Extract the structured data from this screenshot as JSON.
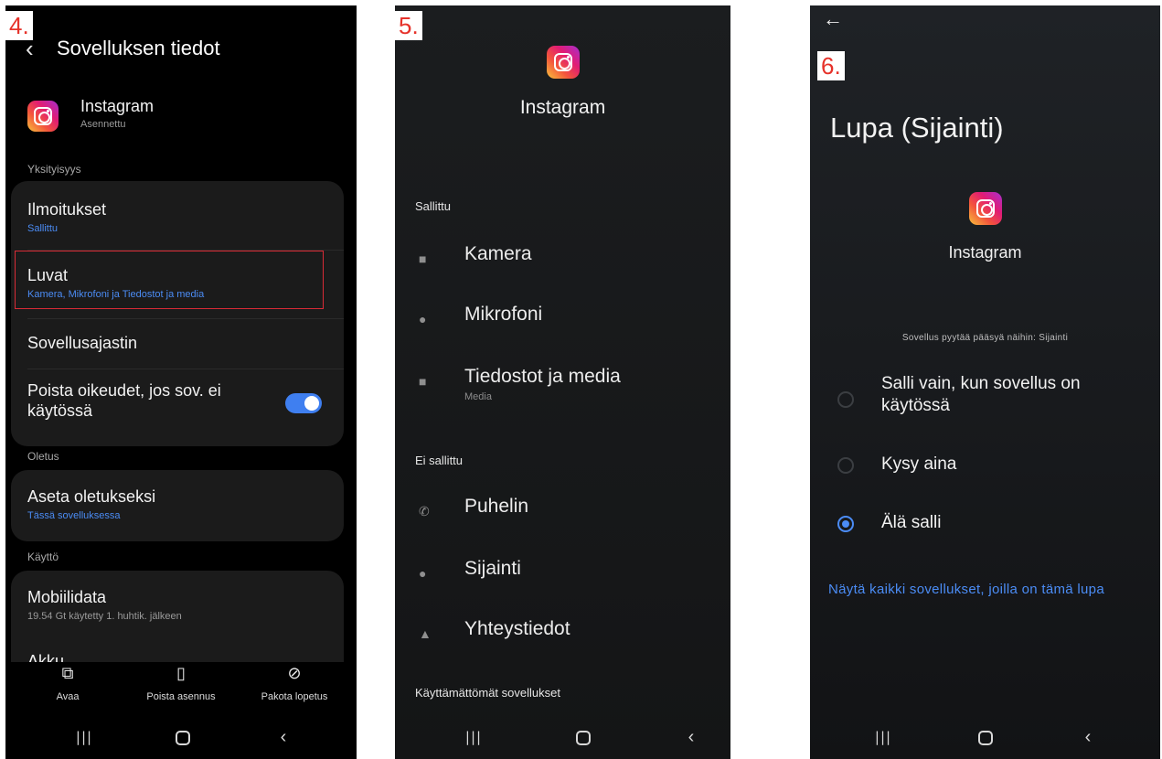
{
  "screen4": {
    "step": "4.",
    "title": "Sovelluksen tiedot",
    "app": {
      "name": "Instagram",
      "status": "Asennettu"
    },
    "sections": {
      "privacy": "Yksityisyys",
      "default": "Oletus",
      "usage": "Käyttö"
    },
    "rows": {
      "notifications": {
        "title": "Ilmoitukset",
        "sub": "Sallittu"
      },
      "permissions": {
        "title": "Luvat",
        "sub": "Kamera, Mikrofoni ja Tiedostot ja media"
      },
      "app_timer": {
        "title": "Sovellusajastin"
      },
      "remove_permissions": {
        "title": "Poista oikeudet, jos sov. ei käytössä",
        "toggle_on": true
      },
      "set_default": {
        "title": "Aseta oletukseksi",
        "sub": "Tässä sovelluksessa"
      },
      "mobile_data": {
        "title": "Mobiilidata",
        "sub": "19.54 Gt käytetty 1. huhtik. jälkeen"
      },
      "battery": {
        "title": "Akku"
      }
    },
    "actions": {
      "open": "Avaa",
      "uninstall": "Poista asennus",
      "force_stop": "Pakota lopetus"
    }
  },
  "screen5": {
    "step": "5.",
    "app_name": "Instagram",
    "allowed_label": "Sallittu",
    "allowed": [
      {
        "label": "Kamera",
        "sub": "",
        "icon": "camera-icon",
        "glyph": "■"
      },
      {
        "label": "Mikrofoni",
        "sub": "",
        "icon": "microphone-icon",
        "glyph": "●"
      },
      {
        "label": "Tiedostot ja media",
        "sub": "Media",
        "icon": "folder-icon",
        "glyph": "■"
      }
    ],
    "denied_label": "Ei sallittu",
    "denied": [
      {
        "label": "Puhelin",
        "icon": "phone-icon",
        "glyph": "✆"
      },
      {
        "label": "Sijainti",
        "icon": "location-icon",
        "glyph": "●"
      },
      {
        "label": "Yhteystiedot",
        "icon": "contacts-icon",
        "glyph": "▲"
      }
    ],
    "unused_label": "Käyttämättömät sovellukset"
  },
  "screen6": {
    "step": "6.",
    "title": "Lupa (Sijainti)",
    "app_name": "Instagram",
    "request_text": "Sovellus pyytää pääsyä näihin: Sijainti",
    "options": [
      {
        "label": "Salli vain, kun sovellus on käytössä",
        "selected": false
      },
      {
        "label": "Kysy aina",
        "selected": false
      },
      {
        "label": "Älä salli",
        "selected": true
      }
    ],
    "link": "Näytä kaikki sovellukset, joilla on tämä lupa"
  },
  "colors": {
    "accent": "#4b8cf5",
    "highlight": "#d92b36",
    "badge_text": "#e6322a"
  }
}
